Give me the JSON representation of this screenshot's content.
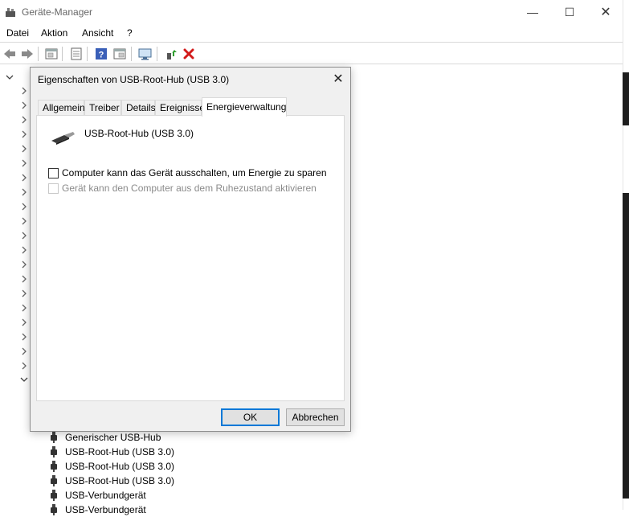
{
  "window": {
    "title": "Geräte-Manager",
    "controls": {
      "minimize": "—",
      "maximize": "☐",
      "close": "✕"
    }
  },
  "menu": [
    "Datei",
    "Aktion",
    "Ansicht",
    "?"
  ],
  "toolbar": {
    "icons": [
      "back-arrow-icon",
      "forward-arrow-icon",
      "device-view-icon",
      "properties-icon",
      "help-icon",
      "update-driver-icon",
      "scan-hardware-icon",
      "enable-device-icon",
      "uninstall-device-icon"
    ]
  },
  "tree": {
    "visible_items": [
      "Generischer USB-Hub",
      "USB-Root-Hub (USB 3.0)",
      "USB-Root-Hub (USB 3.0)",
      "USB-Root-Hub (USB 3.0)",
      "USB-Verbundgerät",
      "USB-Verbundgerät"
    ]
  },
  "dialog": {
    "title": "Eigenschaften von USB-Root-Hub (USB 3.0)",
    "close": "✕",
    "tabs": [
      "Allgemein",
      "Treiber",
      "Details",
      "Ereignisse",
      "Energieverwaltung"
    ],
    "active_tab": "Energieverwaltung",
    "device_name": "USB-Root-Hub (USB 3.0)",
    "options": [
      {
        "label": "Computer kann das Gerät ausschalten, um Energie zu sparen",
        "checked": false,
        "enabled": true
      },
      {
        "label": "Gerät kann den Computer aus dem Ruhezustand aktivieren",
        "checked": false,
        "enabled": false
      }
    ],
    "buttons": {
      "ok": "OK",
      "cancel": "Abbrechen"
    }
  },
  "colors": {
    "accent": "#0078d7",
    "dialog_bg": "#f0f0f0",
    "disabled_text": "#8a8a8a",
    "delete_red": "#d21a1a"
  }
}
